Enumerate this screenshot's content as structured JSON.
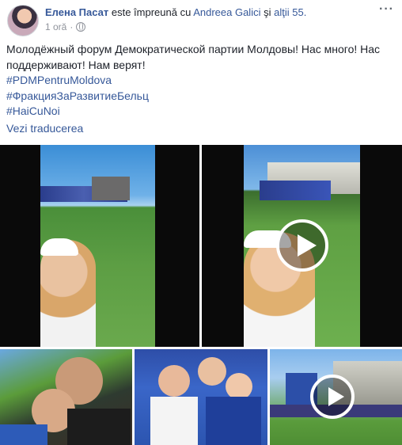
{
  "post": {
    "author": "Елена Пасат",
    "with_text": " este împreună cu ",
    "tagged_person": "Andreea Galici",
    "and_text": " şi ",
    "others": "alţii 55.",
    "time": "1 oră",
    "more_icon": "···",
    "body_text": "Молодёжный форум Демократической партии Молдовы! Нас много! Нас поддерживают! Нам верят!",
    "hashtags": [
      "#PDMPentruMoldova",
      "#ФракцияЗаРазвитиеБельц",
      "#HaiCuNoi"
    ],
    "translate_link": "Vezi traducerea"
  },
  "media": {
    "items": [
      {
        "type": "video",
        "has_play_button": false
      },
      {
        "type": "video",
        "has_play_button": true
      },
      {
        "type": "photo",
        "has_play_button": false
      },
      {
        "type": "photo",
        "has_play_button": false
      },
      {
        "type": "video",
        "has_play_button": true
      }
    ]
  },
  "colors": {
    "link": "#365899",
    "meta": "#90949c",
    "text": "#1d2129"
  }
}
